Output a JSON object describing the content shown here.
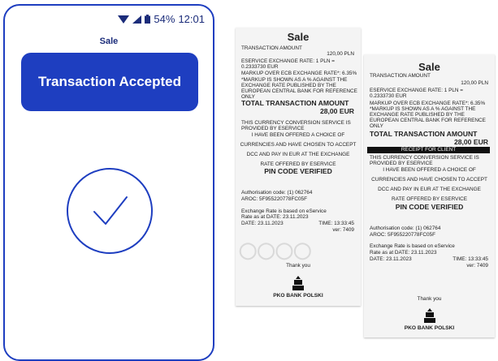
{
  "status": {
    "battery": "54%",
    "time": "12:01"
  },
  "phone": {
    "title": "Sale",
    "banner": "Transaction Accepted"
  },
  "receipt1": {
    "title": "Sale",
    "transaction_amount_label": "TRANSACTION AMOUNT",
    "transaction_amount_value": "120,00 PLN",
    "rate_line1": "ESERVICE EXCHANGE RATE: 1 PLN =",
    "rate_line2": "0.2333730 EUR",
    "markup_line1": "MARKUP OVER ECB EXCHANGE RATE*: 6.35%",
    "markup_line2": "*MARKUP IS SHOWN AS A % AGAINST THE",
    "markup_line3": "EXCHANGE RATE PUBLISHED BY THE",
    "markup_line4": "EUROPEAN CENTRAL BANK FOR REFERENCE",
    "markup_line5": "ONLY",
    "total_label": "TOTAL TRANSACTION AMOUNT",
    "total_value": "28,00 EUR",
    "conv_line1": "THIS CURRENCY CONVERSION SERVICE IS",
    "conv_line2": "PROVIDED BY ESERVICE",
    "conv_line3": "I HAVE BEEN OFFERED A CHOICE OF",
    "conv_line4": "CURRENCIES AND HAVE CHOSEN TO ACCEPT",
    "conv_line5": "DCC AND PAY IN EUR AT THE EXCHANGE",
    "conv_line6": "RATE OFFERED BY ESERVICE",
    "pin": "PIN CODE VERIFIED",
    "auth": "Authorisation code: (1) 062764",
    "aroc": "AROC: 5F955220778FC05F",
    "rate_based": "Exchange Rate is based on eService",
    "rate_date": "Rate as at DATE: 23.11.2023",
    "date": "DATE: 23.11.2023",
    "time": "TIME: 13:33:45",
    "ver": "ver: 7409",
    "thanks": "Thank you",
    "bank": "PKO BANK POLSKI"
  },
  "receipt2": {
    "title": "Sale",
    "transaction_amount_label": "TRANSACTION AMOUNT",
    "transaction_amount_value": "120,00 PLN",
    "rate_line1": "ESERVICE EXCHANGE RATE: 1 PLN =",
    "rate_line2": "0.2333730 EUR",
    "markup_line1": "MARKUP OVER ECB EXCHANGE RATE*: 6.35%",
    "markup_line2": "*MARKUP IS SHOWN AS A % AGAINST THE",
    "markup_line3": "EXCHANGE RATE PUBLISHED BY THE",
    "markup_line4": "EUROPEAN CENTRAL BANK FOR REFERENCE",
    "markup_line5": "ONLY",
    "total_label": "TOTAL TRANSACTION AMOUNT",
    "total_value": "28,00 EUR",
    "client_bar": "RECEIPT FOR CLIENT",
    "conv_line1": "THIS CURRENCY CONVERSION SERVICE IS",
    "conv_line2": "PROVIDED BY ESERVICE",
    "conv_line3": "I HAVE BEEN OFFERED A CHOICE OF",
    "conv_line4": "CURRENCIES AND HAVE CHOSEN TO ACCEPT",
    "conv_line5": "DCC AND PAY IN EUR AT THE EXCHANGE",
    "conv_line6": "RATE OFFERED BY ESERVICE",
    "pin": "PIN CODE VERIFIED",
    "auth": "Authorisation code: (1) 062764",
    "aroc": "AROC: 5F955220778FC05F",
    "rate_based": "Exchange Rate is based on eService",
    "rate_date": "Rate as at DATE: 23.11.2023",
    "date": "DATE: 23.11.2023",
    "time": "TIME: 13:33:45",
    "ver": "ver: 7409",
    "thanks": "Thank you",
    "bank": "PKO BANK POLSKI"
  },
  "colors": {
    "accent": "#1e3ec0",
    "status_text": "#1b2c7a"
  },
  "icons": [
    "wifi-icon",
    "signal-icon",
    "battery-icon",
    "checkmark-icon",
    "bank-logo-icon"
  ]
}
